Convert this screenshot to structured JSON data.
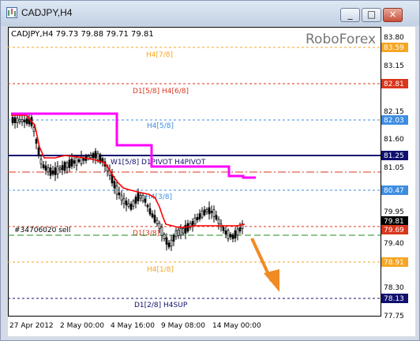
{
  "window": {
    "title": "CADJPY,H4",
    "buttons": [
      "_",
      "□",
      "×"
    ]
  },
  "chart": {
    "header": "CADJPY,H4  79.73 79.88 79.71 79.81",
    "watermark": "RoboForex",
    "position_label": "#34706020 sell",
    "price_axis": [
      "83.80",
      "83.59",
      "83.15",
      "82.81",
      "82.15",
      "82.03",
      "81.60",
      "81.25",
      "81.05",
      "80.47",
      "79.95",
      "79.81",
      "79.69",
      "79.40",
      "78.91",
      "78.30",
      "78.13",
      "77.75"
    ],
    "time_axis": [
      "27 Apr 2012",
      "2 May 00:00",
      "4 May 16:00",
      "9 May 08:00",
      "14 May 00:00"
    ],
    "colors": {
      "murrey_blue": "#3d8de0",
      "murrey_orange": "#f5a623",
      "murrey_red": "#d9361e",
      "pivot": "#10106e",
      "pink_line": "#ff00ff",
      "ma_red": "#ff0000",
      "arrow": "#f08a24"
    },
    "levels": [
      {
        "label": "H4[7/8]",
        "axis": "83.59",
        "color": "orange"
      },
      {
        "label": "D1[5/8] H4[6/8]",
        "axis": "82.81",
        "color": "red"
      },
      {
        "label": "H4[5/8]",
        "axis": "82.03",
        "color": "blue"
      },
      {
        "label": "W1[5/8] D1PIVOT H4PIVOT",
        "axis": "81.25",
        "color": "pivot"
      },
      {
        "label": "H4[3/8]",
        "axis": "80.47",
        "color": "blue"
      },
      {
        "label": "D1[3/8]",
        "axis": "79.69",
        "color": "red"
      },
      {
        "label": "H4[1/8]",
        "axis": "78.91",
        "color": "orange"
      },
      {
        "label": "D1[2/8] H4SUP",
        "axis": "78.13",
        "color": "pivot"
      }
    ]
  }
}
